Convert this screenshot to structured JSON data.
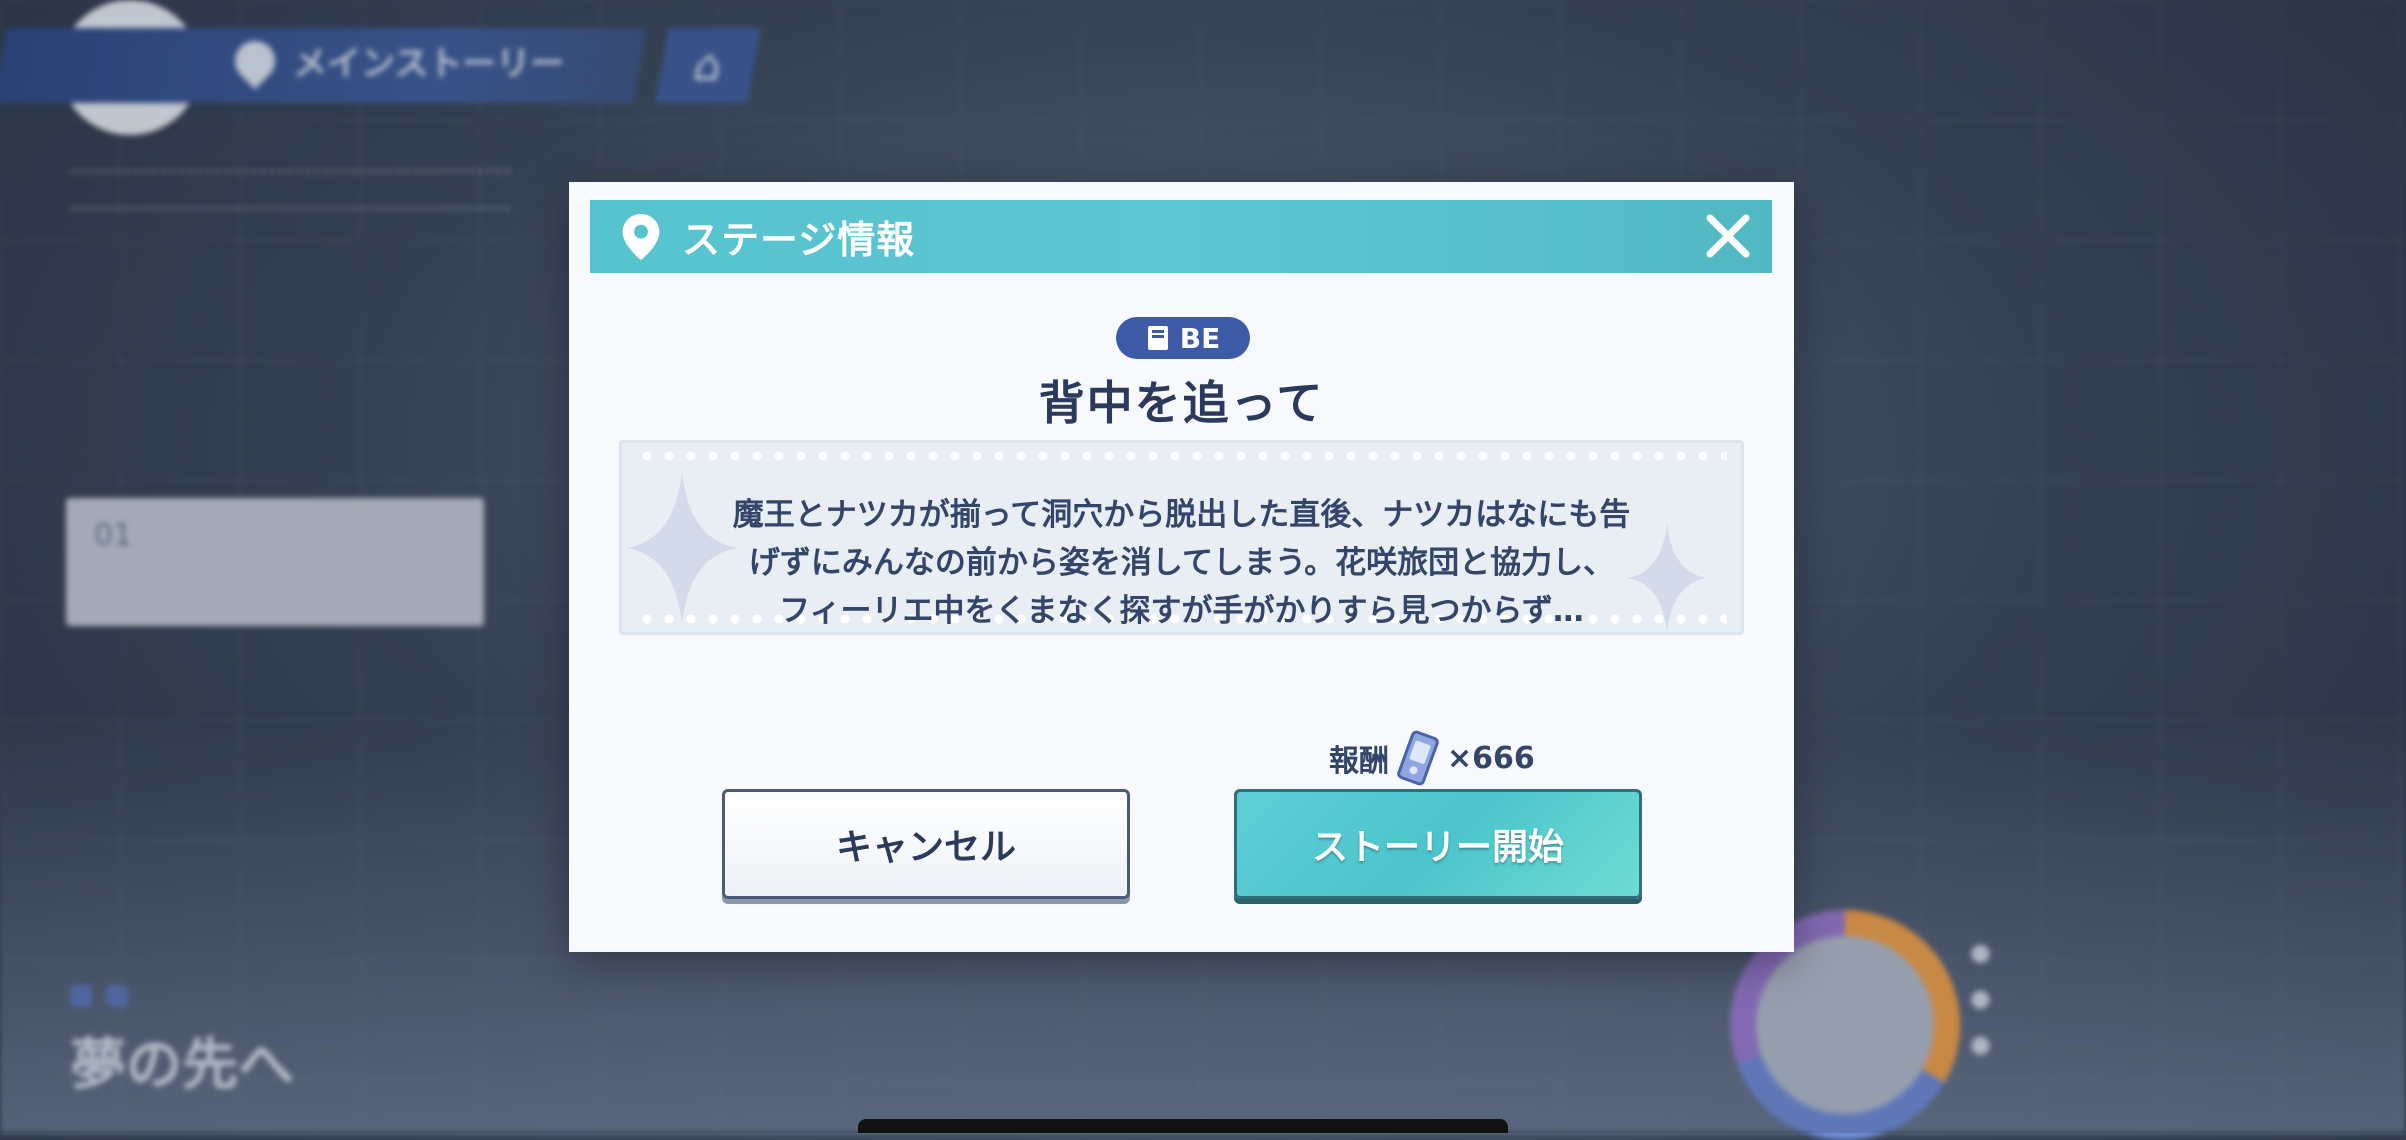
{
  "background": {
    "breadcrumb": "メインストーリー",
    "chapter_title": "夢の先へ",
    "card_number": "01"
  },
  "dialog": {
    "title": "ステージ情報",
    "badge": "BE",
    "stage_title": "背中を追って",
    "description_lines": [
      "魔王とナツカが揃って洞穴から脱出した直後、ナツカはなにも告",
      "げずにみんなの前から姿を消してしまう。花咲旅団と協力し、",
      "フィーリエ中をくまなく探すが手がかりすら見つからず…"
    ],
    "reward_label": "報酬",
    "reward_count": "×666",
    "cancel_label": "キャンセル",
    "start_label": "ストーリー開始"
  },
  "colors": {
    "header": "#56c3cf",
    "badge": "#3d5aa6",
    "text": "#2b3a5c",
    "start_button": "#5fcfd6"
  },
  "icons": [
    "back-arrow-icon",
    "location-pin-icon",
    "home-icon",
    "close-icon",
    "book-icon",
    "ticket-icon"
  ]
}
